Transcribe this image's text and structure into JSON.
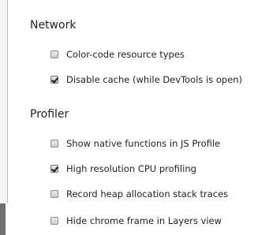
{
  "sections": [
    {
      "title": "Network",
      "options": [
        {
          "label": "Color-code resource types",
          "checked": false
        },
        {
          "label": "Disable cache (while DevTools is open)",
          "checked": true
        }
      ]
    },
    {
      "title": "Profiler",
      "options": [
        {
          "label": "Show native functions in JS Profile",
          "checked": false
        },
        {
          "label": "High resolution CPU profiling",
          "checked": true
        },
        {
          "label": "Record heap allocation stack traces",
          "checked": false
        },
        {
          "label": "Hide chrome frame in Layers view",
          "checked": false
        }
      ]
    }
  ]
}
